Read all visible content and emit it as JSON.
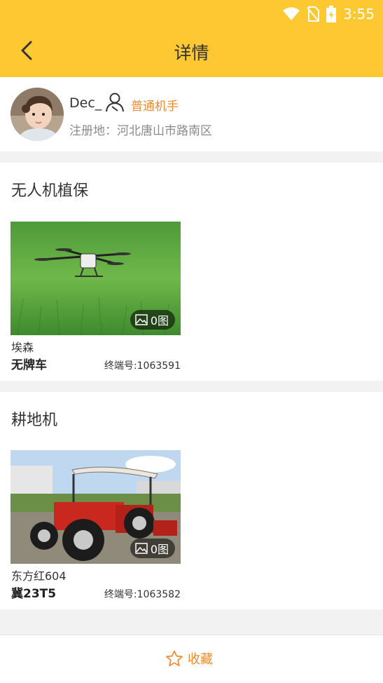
{
  "status": {
    "time": "3:55"
  },
  "header": {
    "title": "详情"
  },
  "profile": {
    "username": "Dec_",
    "role": "普通机手",
    "registration": "注册地：河北唐山市路南区"
  },
  "sections": [
    {
      "title": "无人机植保",
      "card": {
        "name": "埃森",
        "plate": "无牌车",
        "terminal": "终端号:1063591",
        "photo_count": "0图"
      }
    },
    {
      "title": "耕地机",
      "card": {
        "name": "东方红604",
        "plate": "冀23T5",
        "terminal": "终端号:1063582",
        "photo_count": "0图"
      }
    }
  ],
  "bottom": {
    "favorite_label": "收藏"
  },
  "colors": {
    "header_bg": "#fdc832",
    "accent": "#f08a2e"
  },
  "icons": [
    "back-arrow-icon",
    "wifi-icon",
    "no-sim-icon",
    "battery-icon",
    "user-role-icon",
    "image-icon",
    "star-outline-icon"
  ]
}
